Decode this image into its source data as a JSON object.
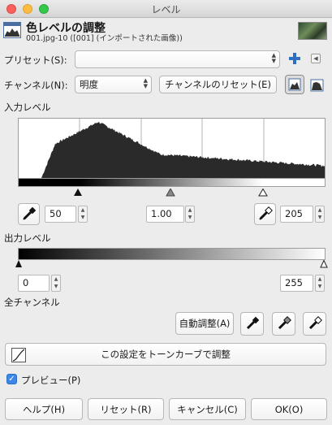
{
  "window": {
    "title": "レベル"
  },
  "header": {
    "title": "色レベルの調整",
    "subtitle": "001.jpg-10 ([001] (インポートされた画像))"
  },
  "presets": {
    "label": "プリセット(S):",
    "value": ""
  },
  "channel": {
    "label": "チャンネル(N):",
    "value": "明度",
    "reset_label": "チャンネルのリセット(E)"
  },
  "input_levels": {
    "label": "入力レベル",
    "low": "50",
    "gamma": "1.00",
    "high": "205"
  },
  "output_levels": {
    "label": "出力レベル",
    "low": "0",
    "high": "255"
  },
  "all_channels": {
    "label": "全チャンネル",
    "auto_label": "自動調整(A)"
  },
  "curves_button_label": "この設定をトーンカーブで調整",
  "preview": {
    "label": "プレビュー(P)",
    "checked": true
  },
  "footer": {
    "help": "ヘルプ(H)",
    "reset": "リセット(R)",
    "cancel": "キャンセル(C)",
    "ok": "OK(O)"
  },
  "colors": {
    "accent": "#3b87e8",
    "histogram": "#2a2a2a"
  }
}
